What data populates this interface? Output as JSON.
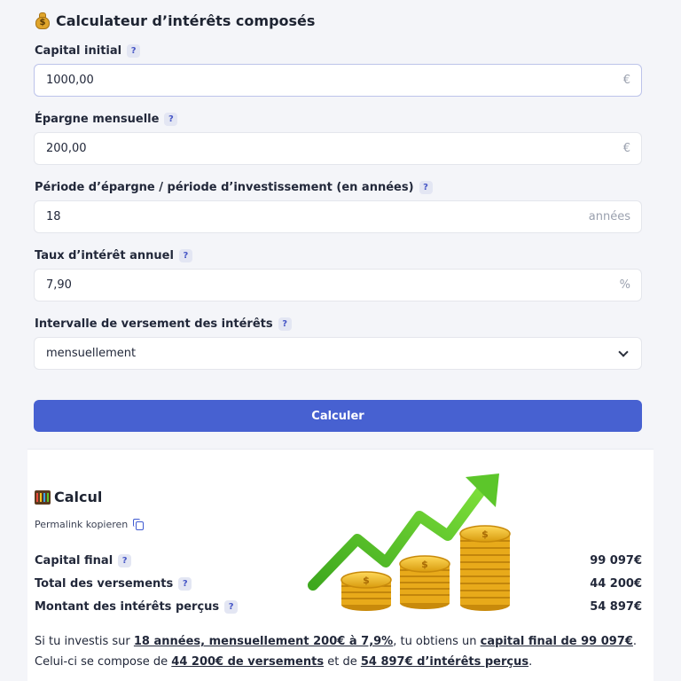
{
  "header": {
    "title": "Calculateur d’intérêts composés"
  },
  "form": {
    "capital": {
      "label": "Capital initial",
      "value": "1000,00",
      "unit": "€"
    },
    "epargne": {
      "label": "Épargne mensuelle",
      "value": "200,00",
      "unit": "€"
    },
    "periode": {
      "label": "Période d’épargne / période d’investissement (en années)",
      "value": "18",
      "unit": "années"
    },
    "taux": {
      "label": "Taux d’intérêt annuel",
      "value": "7,90",
      "unit": "%"
    },
    "intervalle": {
      "label": "Intervalle de versement des intérêts",
      "value": "mensuellement"
    },
    "help": "?",
    "submit_label": "Calculer"
  },
  "result": {
    "title": "Calcul",
    "permalink_label": "Permalink kopieren",
    "rows": [
      {
        "label": "Capital final",
        "value": "99 097€"
      },
      {
        "label": "Total des versements",
        "value": "44 200€"
      },
      {
        "label": "Montant des intérêts perçus",
        "value": "54 897€"
      }
    ],
    "summary": {
      "t1": "Si tu investis sur ",
      "l1": "18 années, mensuellement 200€ à 7,9%",
      "t2": ", tu obtiens un ",
      "l2": "capital final de 99 097€",
      "t3": ". Celui-ci se compose de ",
      "l3": "44 200€ de versements",
      "t4": " et de ",
      "l4": "54 897€ d’intérêts perçus",
      "t5": "."
    }
  },
  "colors": {
    "accent": "#4761d1",
    "help_bg": "#e3e6f3",
    "coin": "#f0b81f",
    "arrow": "#5cc62a"
  },
  "icons": [
    "money-bag-icon",
    "help-icon",
    "euro-icon",
    "chevron-down-icon",
    "abacus-icon",
    "copy-icon",
    "coins-growth-illustration"
  ]
}
